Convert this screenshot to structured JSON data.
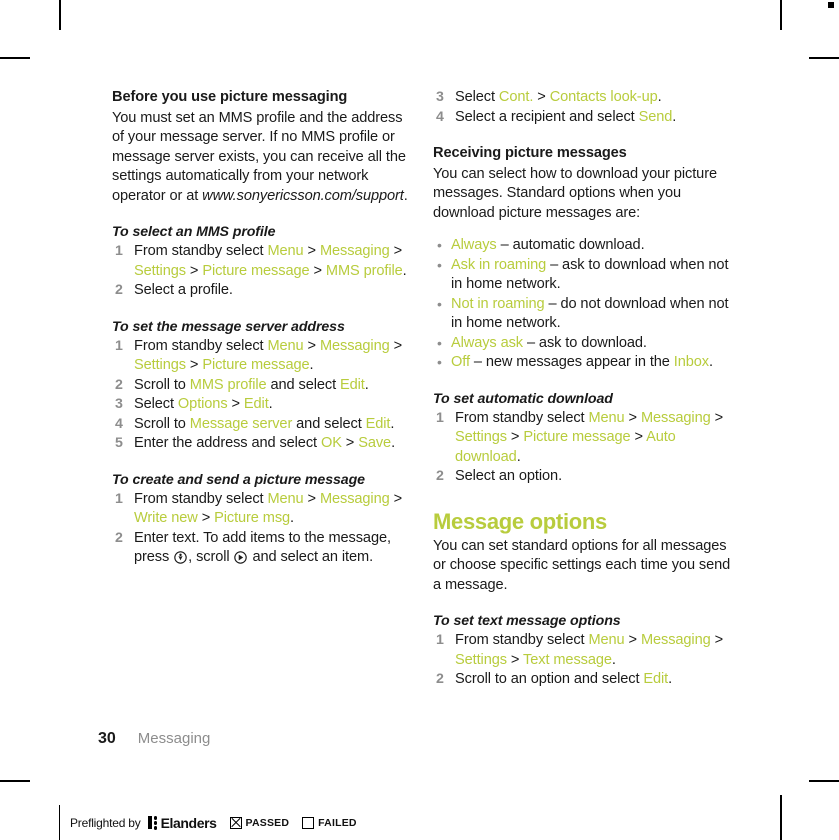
{
  "document": {
    "folio_number": "30",
    "chapter": "Messaging"
  },
  "accent_color": "#b8cc3d",
  "left_column": {
    "intro": {
      "heading": "Before you use picture messaging",
      "body_part1": "You must set an MMS profile and the address of your message server. If no MMS profile or message server exists, you can receive all the settings automatically from your network operator or at ",
      "body_url": "www.sonyericsson.com/support",
      "body_end": "."
    },
    "proc_select_mms_profile": {
      "title": "To select an MMS profile",
      "step1": {
        "lead": "From standby select ",
        "ui1": "Menu",
        "ui2": "Messaging",
        "ui3": "Settings",
        "ui4": "Picture message",
        "ui5": "MMS profile",
        "end": "."
      },
      "step2": "Select a profile."
    },
    "proc_message_server_address": {
      "title": "To set the message server address",
      "step1": {
        "lead": "From standby select ",
        "ui1": "Menu",
        "ui2": "Messaging",
        "ui3": "Settings",
        "ui4": "Picture message",
        "end": "."
      },
      "step2": {
        "lead": "Scroll to ",
        "ui1": "MMS profile",
        "mid": " and select ",
        "ui2": "Edit",
        "end": "."
      },
      "step3": {
        "lead": "Select ",
        "ui1": "Options",
        "ui2": "Edit",
        "end": "."
      },
      "step4": {
        "lead": "Scroll to ",
        "ui1": "Message server",
        "mid": " and select ",
        "ui2": "Edit",
        "end": "."
      },
      "step5": {
        "lead": "Enter the address and select ",
        "ui1": "OK",
        "ui2": "Save",
        "end": "."
      }
    },
    "proc_create_send_picture": {
      "title": "To create and send a picture message",
      "step1": {
        "lead": "From standby select ",
        "ui1": "Menu",
        "ui2": "Messaging",
        "ui3": "Write new",
        "ui4": "Picture msg",
        "end": "."
      },
      "step2": {
        "lead": "Enter text. To add items to the message, press ",
        "icon1": "navigation-key-select-icon",
        "mid": ", scroll ",
        "icon2": "navigation-key-right-icon",
        "end": " and select an item."
      }
    }
  },
  "right_column": {
    "proc_create_send_picture_cont": {
      "step3": {
        "lead": "Select ",
        "ui1": "Cont.",
        "ui2": "Contacts look-up",
        "end": "."
      },
      "step4": {
        "lead": "Select a recipient and select ",
        "ui1": "Send",
        "end": "."
      }
    },
    "receiving": {
      "heading": "Receiving picture messages",
      "body": "You can select how to download your picture messages. Standard options when you download picture messages are:",
      "options": [
        {
          "ui": "Always",
          "desc": " – automatic download."
        },
        {
          "ui": "Ask in roaming",
          "desc": " – ask to download when not in home network."
        },
        {
          "ui": "Not in roaming",
          "desc": " – do not download when not in home network."
        },
        {
          "ui": "Always ask",
          "desc": " – ask to download."
        },
        {
          "ui": "Off",
          "desc_before": " – new messages appear in the ",
          "ui2": "Inbox",
          "desc_after": "."
        }
      ]
    },
    "proc_auto_download": {
      "title": "To set automatic download",
      "step1": {
        "lead": "From standby select ",
        "ui1": "Menu",
        "ui2": "Messaging",
        "ui3": "Settings",
        "ui4": "Picture message",
        "ui5": "Auto download",
        "end": "."
      },
      "step2": "Select an option."
    },
    "message_options": {
      "heading": "Message options",
      "body": "You can set standard options for all messages or choose specific settings each time you send a message.",
      "proc_text_message_options": {
        "title": "To set text message options",
        "step1": {
          "lead": "From standby select ",
          "ui1": "Menu",
          "ui2": "Messaging",
          "ui3": "Settings",
          "ui4": "Text message",
          "end": "."
        },
        "step2": {
          "lead": "Scroll to an option and select ",
          "ui1": "Edit",
          "end": "."
        }
      }
    }
  },
  "preflight": {
    "label": "Preflighted by",
    "brand": "Elanders",
    "passed_label": "PASSED",
    "failed_label": "FAILED"
  },
  "separators": {
    "gt": ">"
  }
}
